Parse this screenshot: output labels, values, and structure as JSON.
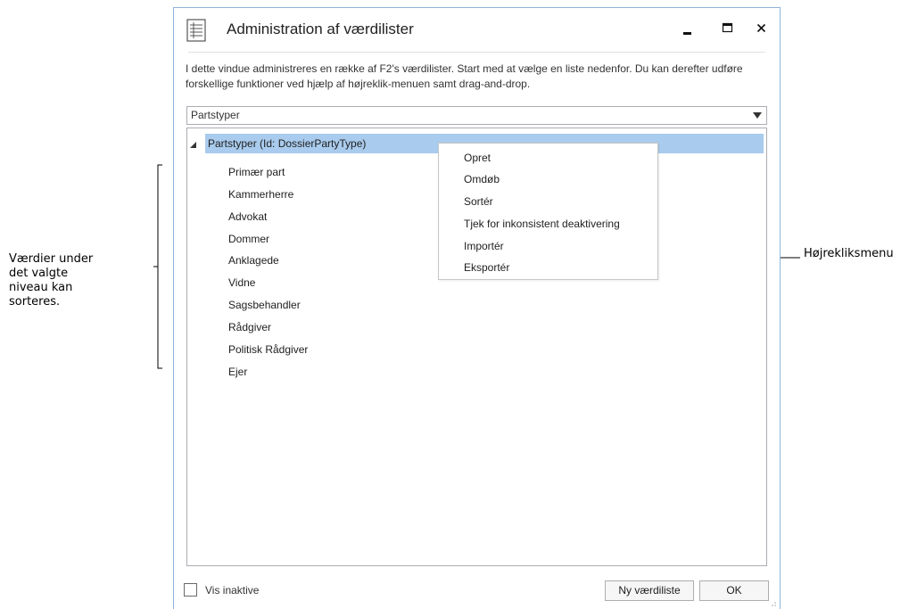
{
  "window": {
    "title": "Administration af værdilister",
    "description": "I dette vindue administreres en række af F2's værdilister. Start med at vælge en liste nedenfor. Du kan derefter udføre forskellige funktioner ved hjælp af højreklik-menuen samt drag-and-drop.",
    "icons": {
      "app": "document-list-icon",
      "minimize": "minimize-icon",
      "maximize": "maximize-icon",
      "close": "close-icon"
    }
  },
  "list_select": {
    "value": "Partstyper"
  },
  "tree": {
    "root_label": "Partstyper (Id: DossierPartyType)",
    "items": [
      "Primær part",
      "Kammerherre",
      "Advokat",
      "Dommer",
      "Anklagede",
      "Vidne",
      "Sagsbehandler",
      "Rådgiver",
      "Politisk Rådgiver",
      "Ejer"
    ]
  },
  "context_menu": {
    "items": [
      "Opret",
      "Omdøb",
      "Sortér",
      "Tjek for inkonsistent deaktivering",
      "Importér",
      "Eksportér"
    ]
  },
  "footer": {
    "show_inactive_label": "Vis inaktive",
    "show_inactive_checked": false,
    "new_list_label": "Ny værdiliste",
    "ok_label": "OK"
  },
  "annotations": {
    "left_lines": [
      "Værdier under",
      "det valgte",
      "niveau kan",
      "sorteres."
    ],
    "right": "Højrekliksmenu"
  },
  "colors": {
    "selection": "#a9cbed",
    "window_border": "#8fb3d9"
  }
}
